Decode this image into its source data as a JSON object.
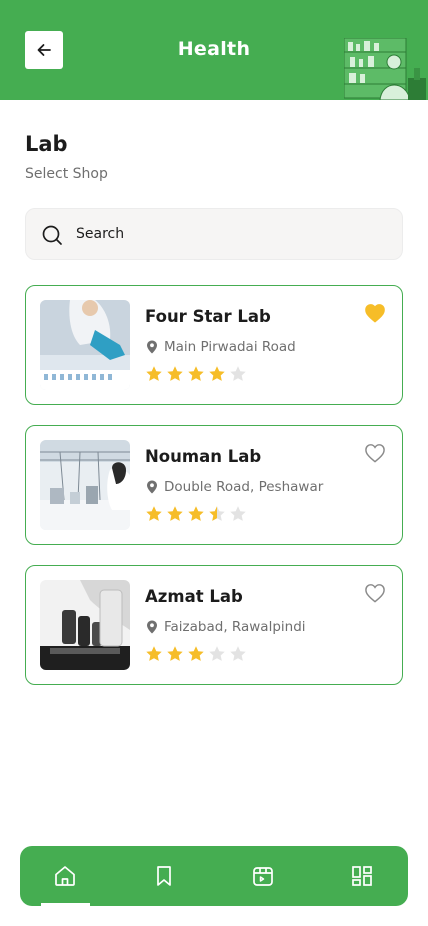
{
  "header": {
    "title": "Health"
  },
  "page": {
    "title": "Lab",
    "subtitle": "Select Shop"
  },
  "search": {
    "placeholder": "Search"
  },
  "labs": [
    {
      "name": "Four Star Lab",
      "address": "Main Pirwadai Road",
      "rating": 4,
      "favorite": true
    },
    {
      "name": "Nouman Lab",
      "address": "Double Road, Peshawar",
      "rating": 3.5,
      "favorite": false
    },
    {
      "name": "Azmat Lab",
      "address": "Faizabad, Rawalpindi",
      "rating": 3,
      "favorite": false
    }
  ],
  "icons": {
    "back": "arrow-left-icon",
    "search": "search-icon",
    "location": "location-pin-icon",
    "favorite": "heart-icon",
    "star": "star-icon",
    "nav": [
      "home-icon",
      "bookmark-icon",
      "calendar-icon",
      "dashboard-icon"
    ]
  },
  "colors": {
    "brand": "#45ad51",
    "star": "#f6bd28",
    "star_empty": "#e3e3e3",
    "favorite": "#f6bd28"
  }
}
